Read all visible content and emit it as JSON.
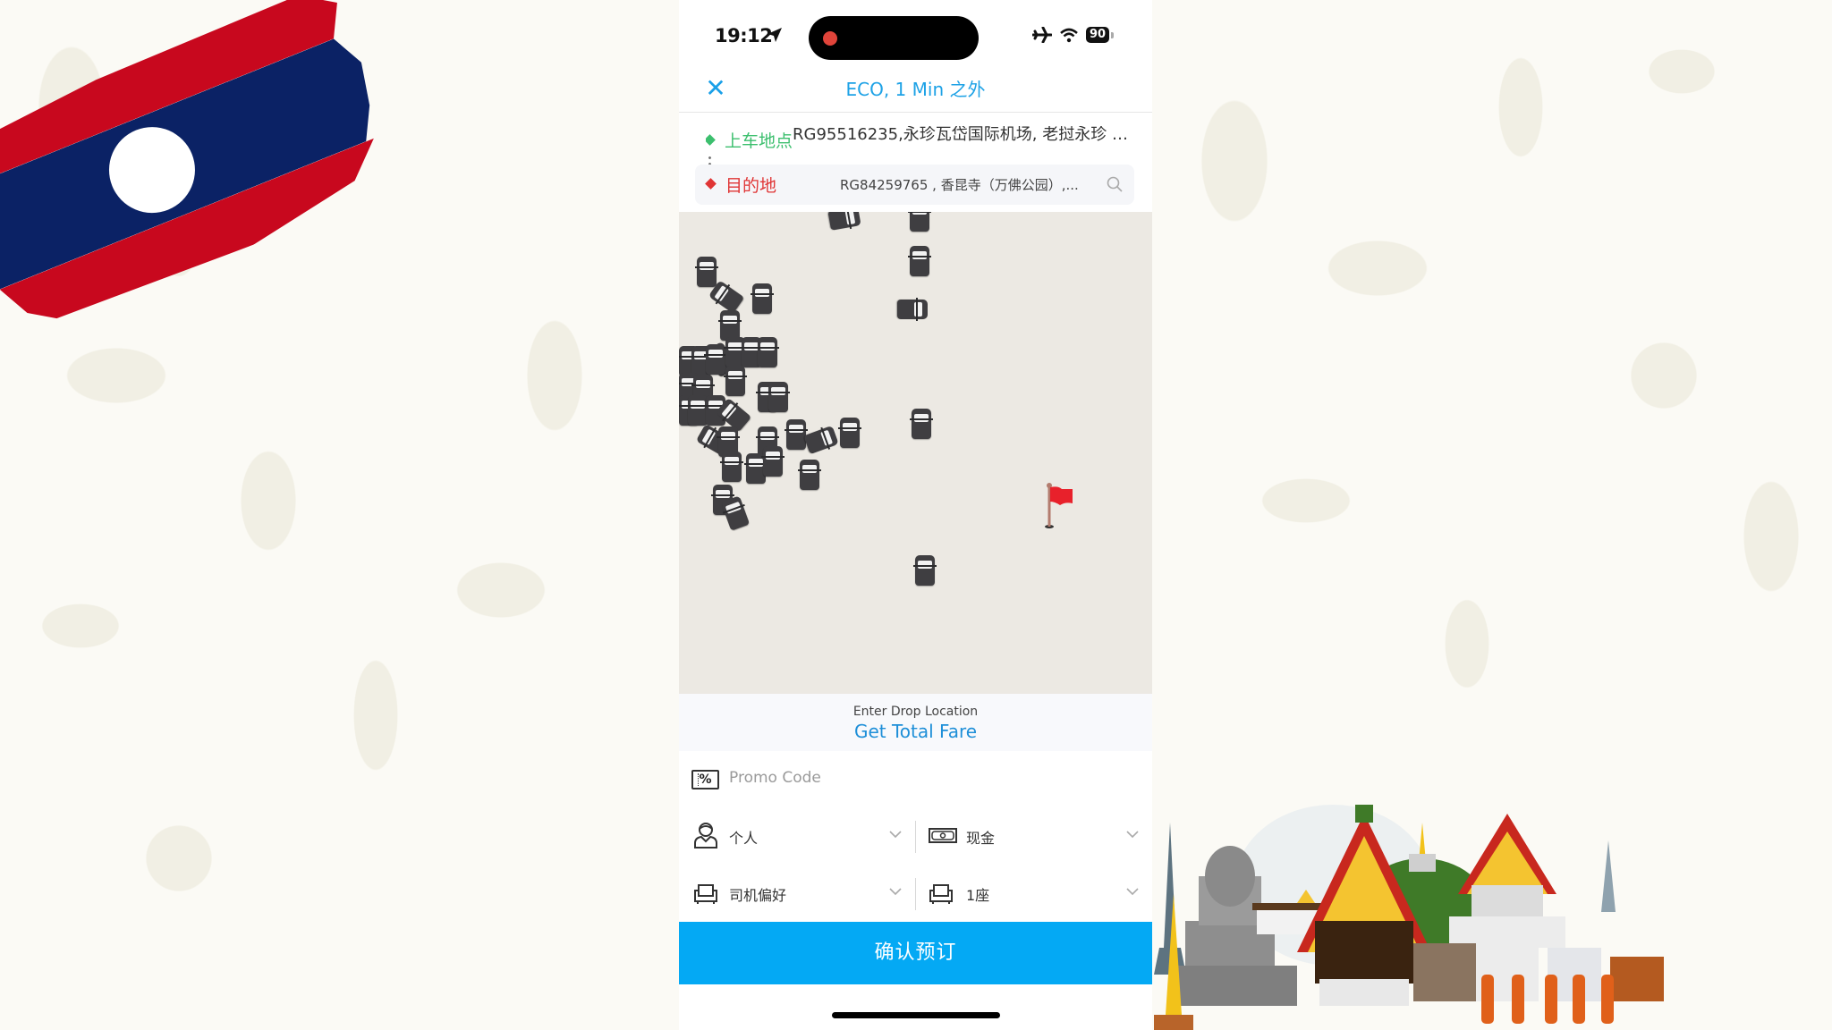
{
  "status_bar": {
    "time": "19:12",
    "battery": "90",
    "icons": [
      "location-arrow-icon",
      "airplane-icon",
      "wifi-icon",
      "battery-icon"
    ],
    "recording_dot_color": "#e0443a"
  },
  "nav": {
    "close_icon": "close-icon",
    "title": "ECO, 1 Min 之外",
    "accent_color": "#1ea2e6"
  },
  "locations": {
    "pickup_label": "上车地点",
    "pickup_address": "RG95516235,永珍瓦岱国际机场, 老挝永珍 ཀ...",
    "destination_label": "目的地",
    "destination_address": "RG84259765 , 香昆寺（万佛公园）,...",
    "pickup_color": "#3cbf6e",
    "destination_color": "#e03535"
  },
  "map": {
    "destination_marker": "red-flag-icon",
    "vehicle_icon": "car-icon"
  },
  "fare": {
    "hint": "Enter Drop Location",
    "link": "Get Total Fare"
  },
  "promo": {
    "placeholder": "Promo Code",
    "value": ""
  },
  "options": {
    "account_type": "个人",
    "payment": "现金",
    "driver_preference": "司机偏好",
    "seats": "1座"
  },
  "confirm_button": "确认预订",
  "confirm_color": "#04a9f4"
}
